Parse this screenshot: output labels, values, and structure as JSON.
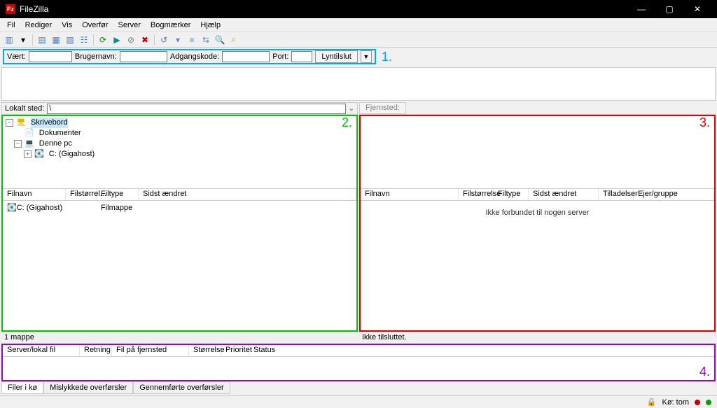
{
  "window": {
    "title": "FileZilla"
  },
  "menu": {
    "items": [
      "Fil",
      "Rediger",
      "Vis",
      "Overfør",
      "Server",
      "Bogmærker",
      "Hjælp"
    ]
  },
  "quickconnect": {
    "host_label": "Vært:",
    "user_label": "Brugernavn:",
    "pass_label": "Adgangskode:",
    "port_label": "Port:",
    "button": "Lyntilslut"
  },
  "annotations": {
    "one": "1.",
    "two": "2.",
    "three": "3.",
    "four": "4."
  },
  "local": {
    "path_label": "Lokalt sted:",
    "path_value": "\\",
    "tree": {
      "root": "Skrivebord",
      "n1": "Dokumenter",
      "n2": "Denne pc",
      "n3": "C: (Gigahost)"
    },
    "cols": {
      "name": "Filnavn",
      "size": "Filstørrel...",
      "type": "Filtype",
      "modified": "Sidst ændret"
    },
    "row1": {
      "name": "C: (Gigahost)",
      "type": "Filmappe"
    },
    "status": "1 mappe"
  },
  "remote": {
    "path_label": "Fjernsted:",
    "cols": {
      "name": "Filnavn",
      "size": "Filstørrelse",
      "type": "Filtype",
      "modified": "Sidst ændret",
      "perm": "Tilladelser",
      "owner": "Ejer/gruppe"
    },
    "placeholder": "Ikke forbundet til nogen server",
    "status": "Ikke tilsluttet."
  },
  "queue": {
    "cols": {
      "file": "Server/lokal fil",
      "dir": "Retning",
      "remote": "Fil på fjernsted",
      "size": "Størrelse",
      "prio": "Prioritet",
      "status": "Status"
    },
    "tabs": {
      "queued": "Filer i kø",
      "failed": "Mislykkede overførsler",
      "done": "Gennemførte overførsler"
    }
  },
  "statusbar": {
    "queue_label": "Kø: tom"
  },
  "colors": {
    "annot1": "#00a8f0",
    "annot2": "#00c800",
    "annot3": "#e00000",
    "annot4": "#a000c0"
  }
}
